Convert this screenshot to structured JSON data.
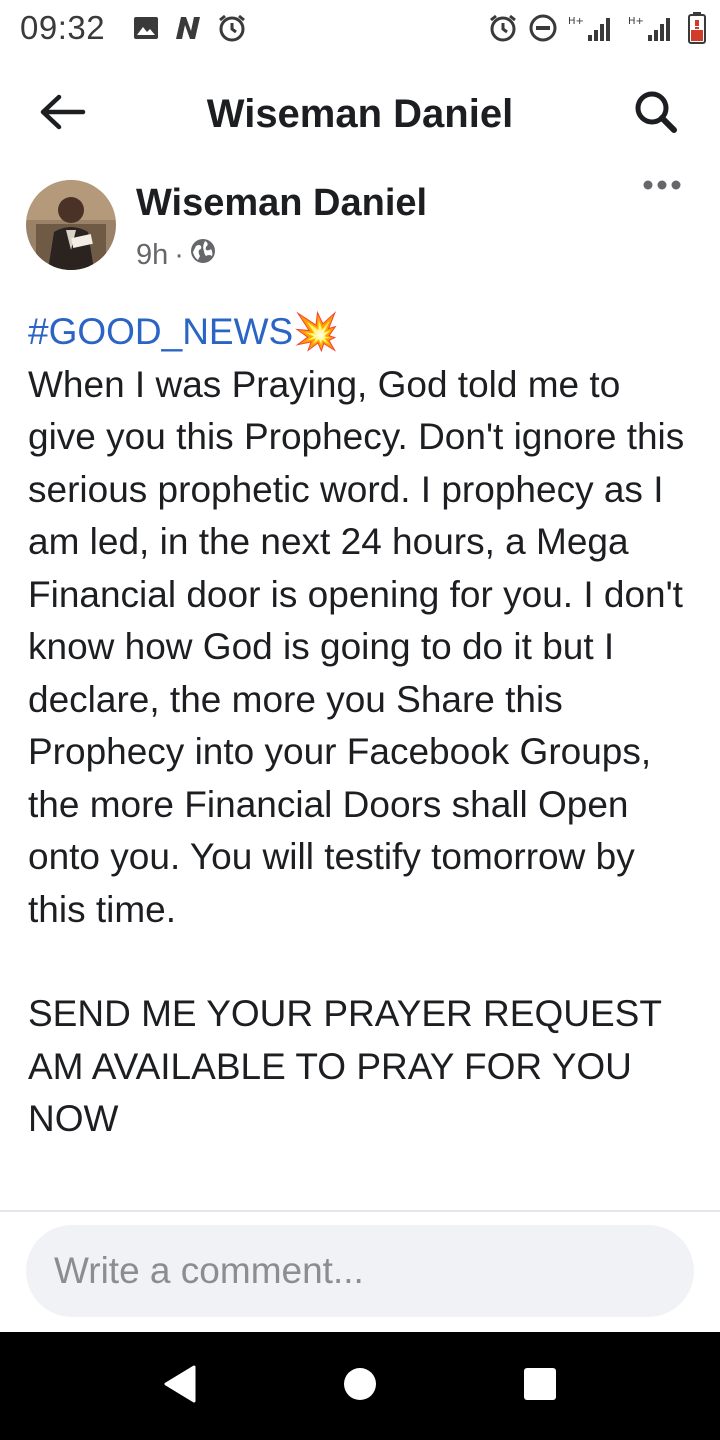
{
  "status_bar": {
    "time": "09:32",
    "left_icons": [
      "image-icon",
      "n-notification-icon",
      "alarm-icon"
    ],
    "right_icons": [
      "alarm-icon",
      "do-not-disturb-icon",
      "signal-h-plus-icon",
      "signal-h-plus-icon",
      "battery-icon"
    ]
  },
  "header": {
    "title": "Wiseman Daniel",
    "back_icon": "arrow-left-icon",
    "search_icon": "search-icon"
  },
  "post": {
    "author": "Wiseman Daniel",
    "time": "9h",
    "separator": "·",
    "audience_icon": "globe-icon",
    "more_icon": "more-horizontal-icon",
    "hashtag": "#GOOD_NEWS",
    "hashtag_emoji": "💥",
    "body": "When I was Praying, God told me to give you this Prophecy. Don't ignore this serious prophetic word. I prophecy as I am led, in the next 24 hours, a Mega Financial door is opening for you. I don't know how God is going to do it but I declare, the more you Share this Prophecy into your Facebook Groups, the more Financial Doors shall Open onto you. You will testify tomorrow by this time.",
    "request_text": "SEND ME YOUR PRAYER REQUEST AM AVAILABLE TO PRAY FOR YOU NOW"
  },
  "comment": {
    "placeholder": "Write a comment..."
  },
  "nav": {
    "back_icon": "triangle-back-icon",
    "home_icon": "circle-home-icon",
    "recents_icon": "square-recents-icon"
  },
  "colors": {
    "hashtag": "#2a64c5",
    "text": "#1c1e21",
    "meta": "#65676b",
    "comment_bg": "#f0f2f5",
    "nav_bg": "#000000"
  }
}
